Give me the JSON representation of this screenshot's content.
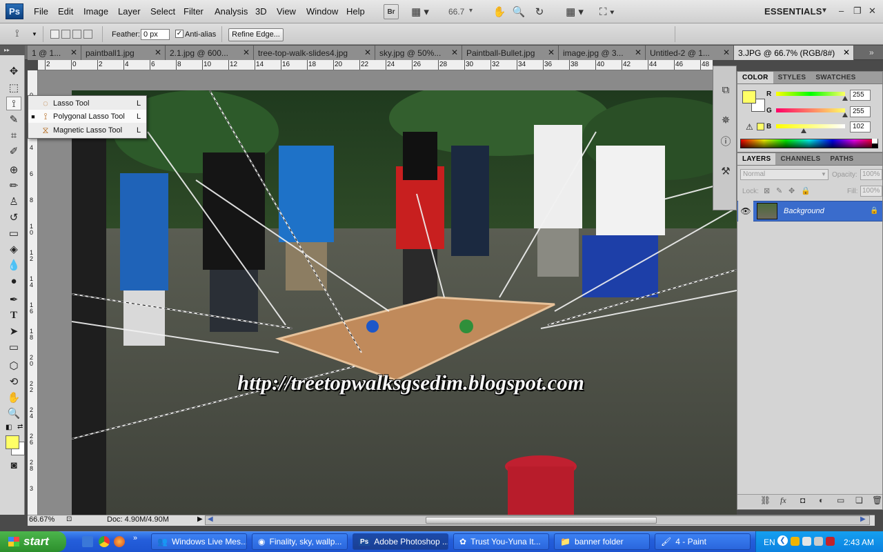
{
  "app": {
    "logo": "Ps"
  },
  "menu": [
    "File",
    "Edit",
    "Image",
    "Layer",
    "Select",
    "Filter",
    "Analysis",
    "3D",
    "View",
    "Window",
    "Help"
  ],
  "menubar": {
    "zoom": "66.7",
    "workspace": "ESSENTIALS",
    "br": "Br"
  },
  "options": {
    "feather_label": "Feather:",
    "feather_value": "0 px",
    "antialias_label": "Anti-alias",
    "antialias_checked": true,
    "refine_edge": "Refine Edge..."
  },
  "tabs": [
    {
      "label": "1 @ 1...",
      "active": false
    },
    {
      "label": "paintball1.jpg",
      "active": false
    },
    {
      "label": "2.1.jpg @ 600...",
      "active": false
    },
    {
      "label": "tree-top-walk-slides4.jpg",
      "active": false
    },
    {
      "label": "sky.jpg @ 50%...",
      "active": false
    },
    {
      "label": "Paintball-Bullet.jpg",
      "active": false
    },
    {
      "label": "image.jpg @ 3...",
      "active": false
    },
    {
      "label": "Untitled-2 @ 1...",
      "active": false
    },
    {
      "label": "3.JPG @ 66.7% (RGB/8#)",
      "active": true
    }
  ],
  "flyout": [
    {
      "label": "Lasso Tool",
      "shortcut": "L",
      "selected": false
    },
    {
      "label": "Polygonal Lasso Tool",
      "shortcut": "L",
      "selected": true
    },
    {
      "label": "Magnetic Lasso Tool",
      "shortcut": "L",
      "selected": false
    }
  ],
  "ruler_top": [
    "2",
    "0",
    "2",
    "4",
    "6",
    "8",
    "10",
    "12",
    "14",
    "16",
    "18",
    "20",
    "22",
    "24",
    "26",
    "28",
    "30",
    "32",
    "34",
    "36",
    "38",
    "40",
    "42",
    "44",
    "46",
    "48"
  ],
  "ruler_left": [
    "0",
    "2",
    "4",
    "6",
    "8",
    "10",
    "12",
    "14",
    "16",
    "18",
    "20",
    "22",
    "24",
    "26",
    "28",
    "3"
  ],
  "canvas": {
    "watermark": "http://treetopwalksgsedim.blogspot.com"
  },
  "status": {
    "zoom": "66.67%",
    "doc": "Doc: 4.90M/4.90M"
  },
  "color_panel": {
    "tabs": [
      "COLOR",
      "STYLES",
      "SWATCHES"
    ],
    "channels": [
      {
        "name": "R",
        "value": "255",
        "fraction": 1.0
      },
      {
        "name": "G",
        "value": "255",
        "fraction": 1.0
      },
      {
        "name": "B",
        "value": "102",
        "fraction": 0.4
      }
    ],
    "foreground": "#ffff66",
    "background": "#ffffff"
  },
  "layers_panel": {
    "tabs": [
      "LAYERS",
      "CHANNELS",
      "PATHS"
    ],
    "blend": "Normal",
    "opacity_label": "Opacity:",
    "opacity": "100%",
    "lock_label": "Lock:",
    "fill_label": "Fill:",
    "fill": "100%",
    "layer_name": "Background"
  },
  "taskbar": {
    "start": "start",
    "buttons": [
      {
        "label": "Windows Live Mes...",
        "active": false
      },
      {
        "label": "Finality, sky, wallp...",
        "active": false
      },
      {
        "label": "Adobe Photoshop ...",
        "active": true
      },
      {
        "label": "Trust You-Yuna It...",
        "active": false
      },
      {
        "label": "banner folder",
        "active": false
      },
      {
        "label": "4 - Paint",
        "active": false
      }
    ],
    "lang": "EN",
    "clock": "2:43 AM"
  },
  "colors": {
    "accent": "#3a6ccc",
    "taskbar": "#245edb",
    "start": "#2c8f2c",
    "fg_swatch": "#ffff66"
  }
}
